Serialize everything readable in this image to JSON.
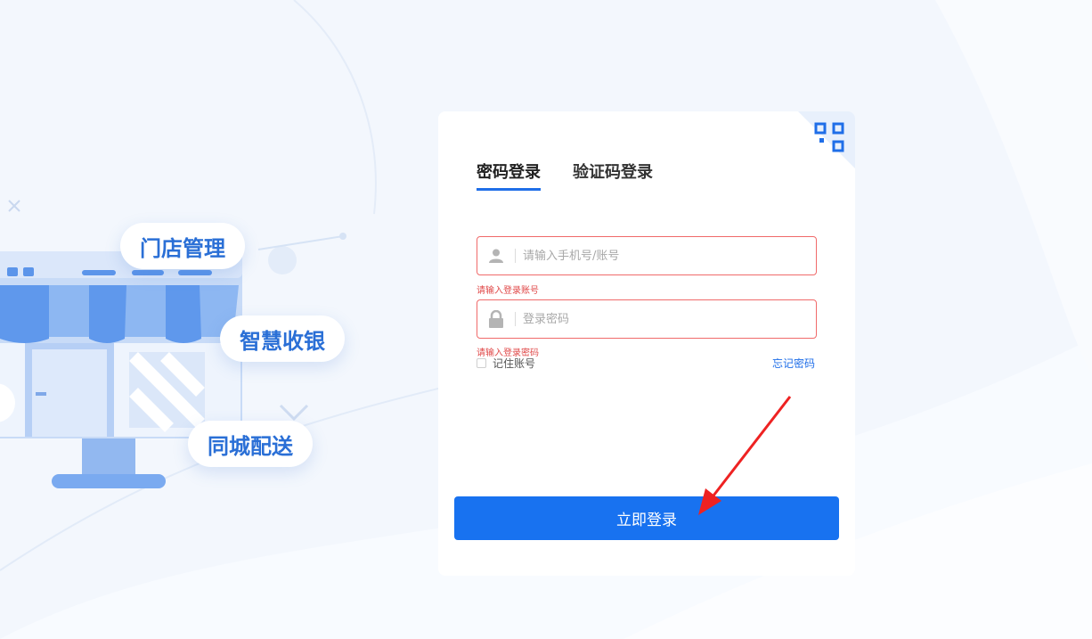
{
  "features": {
    "store_management": "门店管理",
    "smart_cashier": "智慧收银",
    "local_delivery": "同城配送"
  },
  "login": {
    "tabs": [
      {
        "label": "密码登录",
        "active": true
      },
      {
        "label": "验证码登录",
        "active": false
      }
    ],
    "account_placeholder": "请输入手机号/账号",
    "account_error": "请输入登录账号",
    "password_placeholder": "登录密码",
    "password_error": "请输入登录密码",
    "remember_label": "记住账号",
    "forgot_label": "忘记密码",
    "submit_label": "立即登录"
  },
  "icons": {
    "account": "user-icon",
    "password": "lock-icon",
    "qr": "qr-code-icon"
  },
  "colors": {
    "accent": "#1872f0",
    "error": "#e04848",
    "feature_text": "#2a6fd6"
  }
}
